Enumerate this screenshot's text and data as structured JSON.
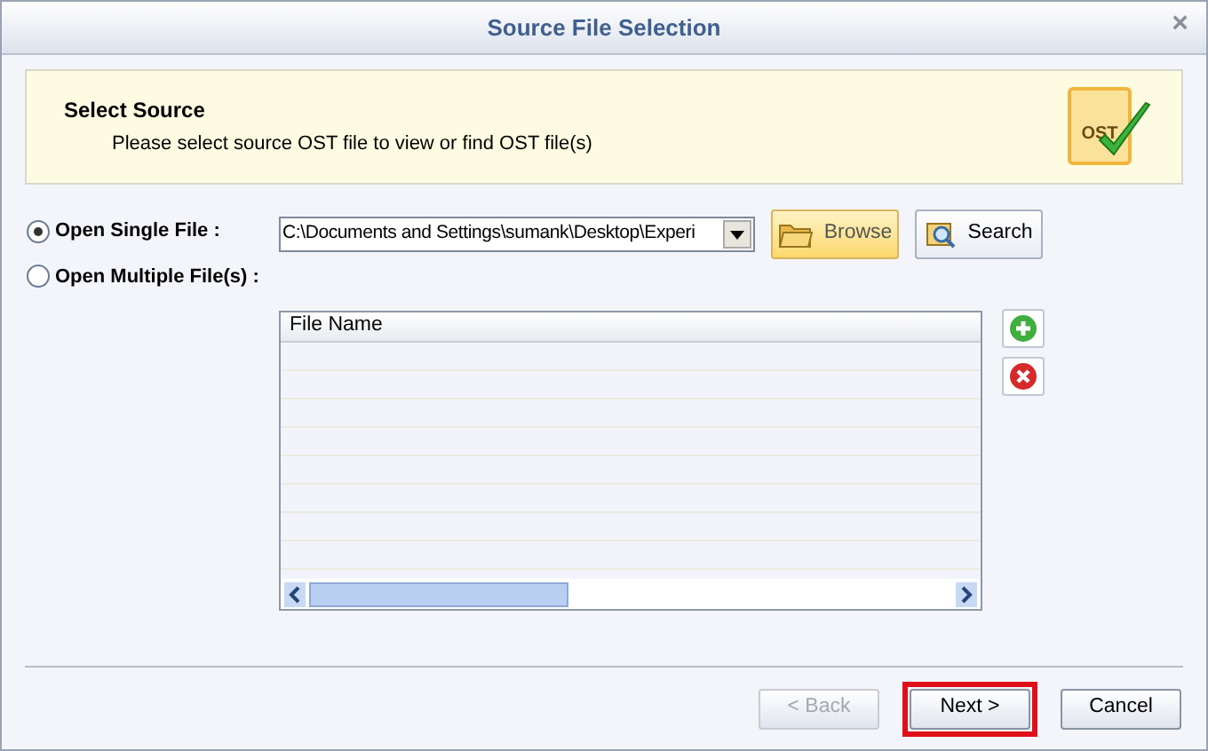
{
  "window": {
    "title": "Source File Selection",
    "close": "×"
  },
  "banner": {
    "heading": "Select Source",
    "description": "Please select source OST file to view or find OST file(s)",
    "logo_text": "OST"
  },
  "options": [
    {
      "label": "Open Single File :",
      "selected": true
    },
    {
      "label": "Open Multiple File(s) :",
      "selected": false
    }
  ],
  "path_field": {
    "value": "C:\\Documents and Settings\\sumank\\Desktop\\Experi"
  },
  "tool_buttons": [
    {
      "kind": "browse",
      "label": "Browse",
      "highlighted": true
    },
    {
      "kind": "search",
      "label": "Search",
      "highlighted": false
    }
  ],
  "file_list": {
    "columns": [
      "File Name"
    ]
  },
  "buttons": [
    {
      "label": "< Back",
      "disabled": true,
      "highlighted": false
    },
    {
      "label": "Next >",
      "disabled": false,
      "highlighted": true
    },
    {
      "label": "Cancel",
      "disabled": false,
      "highlighted": false
    }
  ]
}
